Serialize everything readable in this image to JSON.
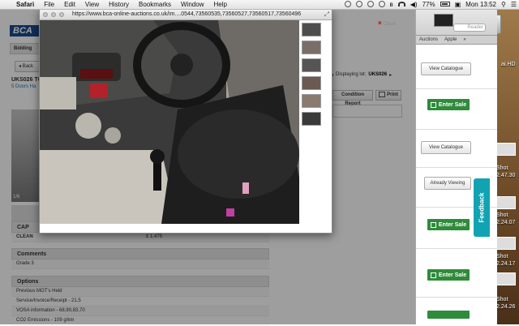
{
  "menubar": {
    "app": "Safari",
    "items": [
      "File",
      "Edit",
      "View",
      "History",
      "Bookmarks",
      "Window",
      "Help"
    ],
    "battery": "77%",
    "clock": "Mon 13:52"
  },
  "popup": {
    "url": "https://www.bca-online-auctions.co.uk/im....0544,73560535,73560527,73560517,73560496",
    "close_label": "Close",
    "thumbnail_count": 6
  },
  "page": {
    "logo": "BCA",
    "tab_bidding": "Bidding",
    "back_label": "Back",
    "lot_title": "UKS026 TO",
    "lot_subtitle": "5 Doors Ha",
    "photo_counter": "1/6",
    "displaying_label": "Displaying lot:",
    "displaying_lot": "UKS026",
    "condition_report": "Condition Report",
    "print_label": "Print",
    "sections": {
      "cap": {
        "heading": "CAP",
        "rows": [
          {
            "label": "CLEAN",
            "value": "£ 1,475"
          }
        ]
      },
      "comments": {
        "heading": "Comments",
        "rows": [
          "Grade 3"
        ]
      },
      "options": {
        "heading": "Options",
        "rows": [
          "Previous MOT's Held",
          "Service/Invoice/Receipt - 21.5",
          "VOSA information - 68,90,83,70",
          "CO2 Emissions - 109 g/km"
        ]
      }
    }
  },
  "background_window": {
    "reader_label": "Reader",
    "tabs": [
      "Auctions",
      "Apple"
    ],
    "view_catalogue": "View Catalogue",
    "enter_sale": "Enter Sale",
    "already_viewing": "Already Viewing",
    "feedback": "Feedback"
  },
  "desktop": {
    "labels": [
      "Shot",
      "2.47.30",
      "Shot",
      "2.24.07",
      "Shot",
      "2.24.17",
      "Shot",
      "2.24.26"
    ]
  }
}
